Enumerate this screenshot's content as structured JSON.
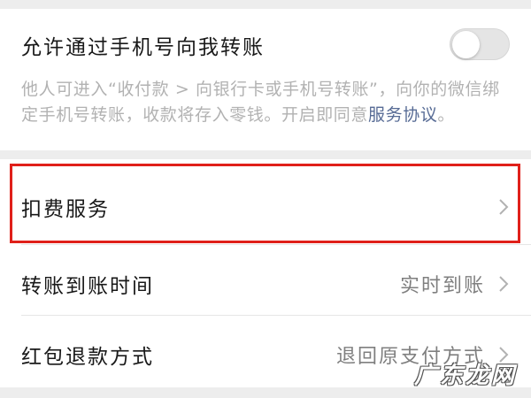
{
  "transfer_by_phone": {
    "title": "允许通过手机号向我转账",
    "enabled": false,
    "description_text": "他人可进入“收付款 > 向银行卡或手机号转账”，向你的微信绑定手机号转账，收款将存入零钱。开启即同意",
    "agreement_link": "服务协议",
    "description_end": "。"
  },
  "settings_rows": [
    {
      "label": "扣费服务",
      "value": "",
      "highlighted": true
    },
    {
      "label": "转账到账时间",
      "value": "实时到账"
    },
    {
      "label": "红包退款方式",
      "value": "退回原支付方式"
    }
  ],
  "watermark": {
    "text": "广东龙网"
  },
  "colors": {
    "background": "#ededed",
    "card": "#ffffff",
    "link": "#576b95",
    "highlight_border": "#e0201a",
    "secondary_text": "#b2b2b2"
  },
  "icons": {
    "toggle": "switch-off",
    "row_arrow": "chevron-right-icon"
  }
}
